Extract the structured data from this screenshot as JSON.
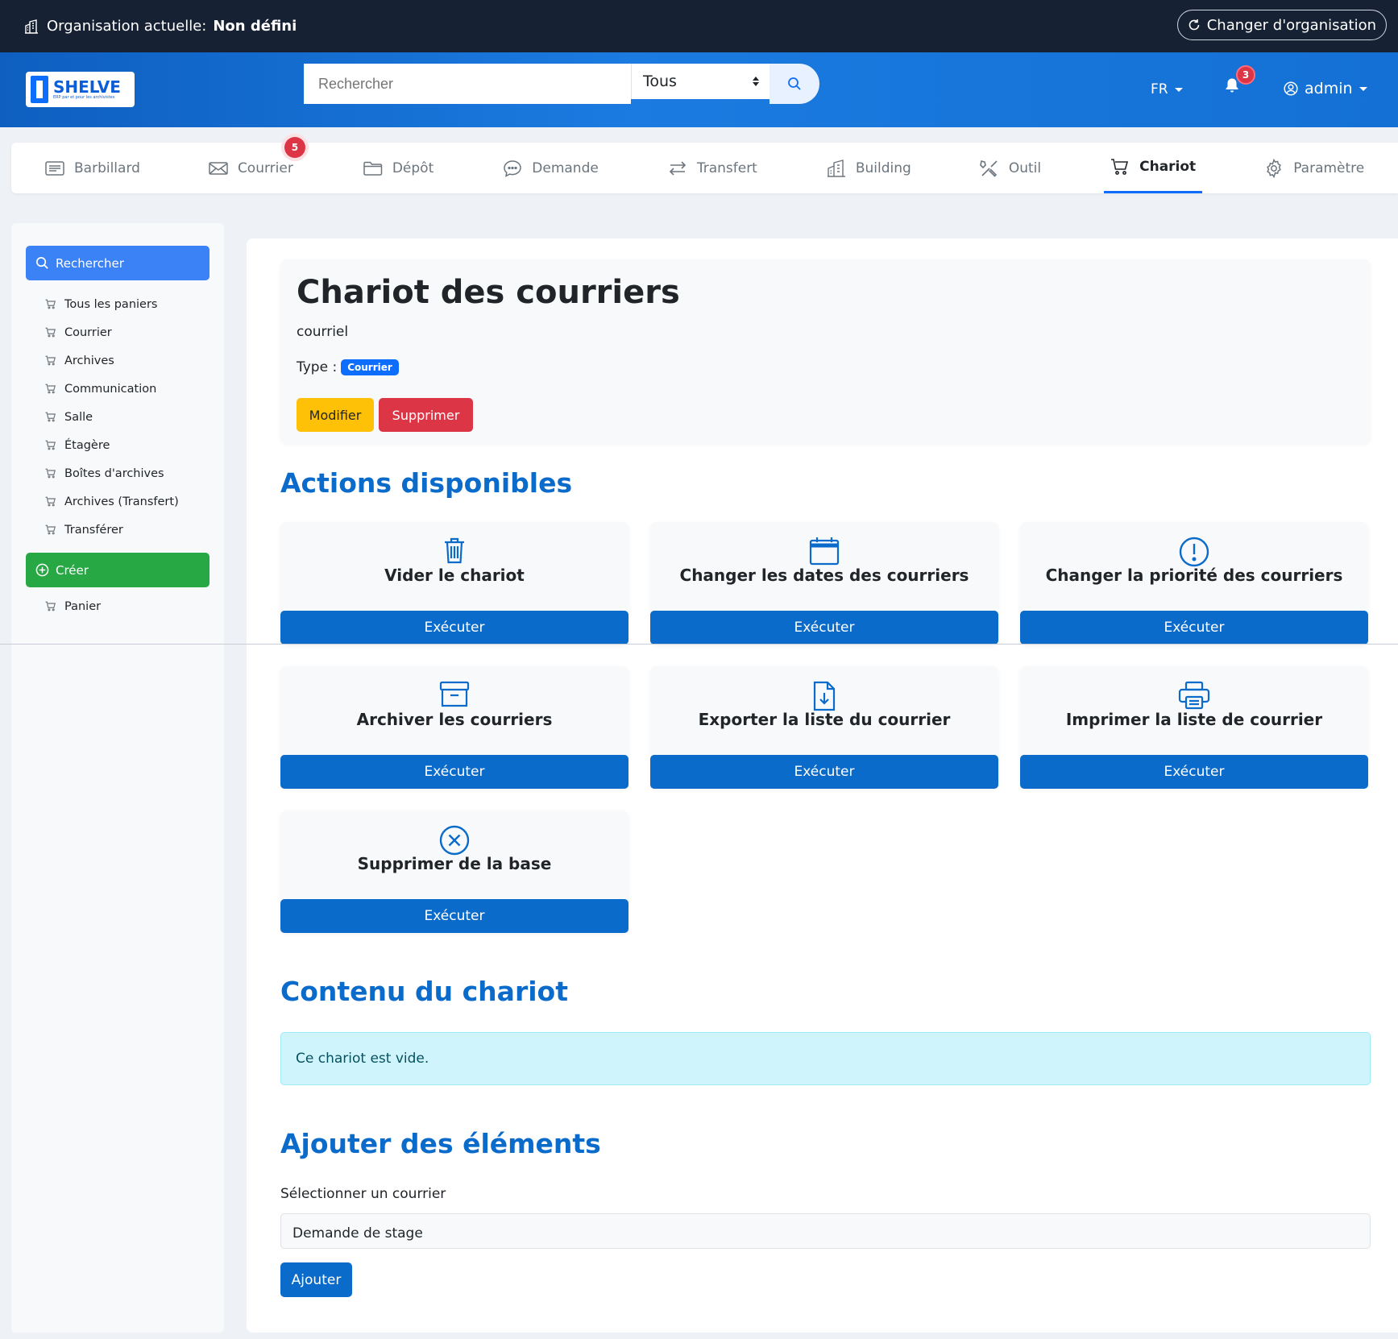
{
  "topbar": {
    "org_label": "Organisation actuelle:",
    "org_value": "Non défini",
    "change_org": "Changer d'organisation"
  },
  "header": {
    "logo_name": "SHELVE",
    "logo_tagline": "ERP par et pour les archivistes",
    "search_placeholder": "Rechercher",
    "search_scope": "Tous",
    "lang": "FR",
    "notifications": "3",
    "user": "admin"
  },
  "nav": [
    {
      "label": "Barbillard",
      "icon": "bulletin-icon"
    },
    {
      "label": "Courrier",
      "icon": "envelope-icon",
      "badge": "5"
    },
    {
      "label": "Dépôt",
      "icon": "folder-icon"
    },
    {
      "label": "Demande",
      "icon": "chat-icon"
    },
    {
      "label": "Transfert",
      "icon": "transfer-arrows-icon"
    },
    {
      "label": "Building",
      "icon": "building-icon"
    },
    {
      "label": "Outil",
      "icon": "tools-icon"
    },
    {
      "label": "Chariot",
      "icon": "cart-icon",
      "active": true
    },
    {
      "label": "Paramètre",
      "icon": "gear-icon"
    }
  ],
  "sidebar": {
    "search_button": "Rechercher",
    "items": [
      "Tous les paniers",
      "Courrier",
      "Archives",
      "Communication",
      "Salle",
      "Étagère",
      "Boîtes d'archives",
      "Archives (Transfert)",
      "Transférer"
    ],
    "create_button": "Créer",
    "create_items": [
      "Panier"
    ]
  },
  "cart": {
    "title": "Chariot des courriers",
    "description": "courriel",
    "type_label": "Type :",
    "type_value": "Courrier",
    "edit_button": "Modifier",
    "delete_button": "Supprimer"
  },
  "actions_section": {
    "title": "Actions disponibles",
    "execute_label": "Exécuter",
    "items": [
      {
        "label": "Vider le chariot",
        "icon": "trash-icon"
      },
      {
        "label": "Changer les dates des courriers",
        "icon": "calendar-icon"
      },
      {
        "label": "Changer la priorité des courriers",
        "icon": "exclamation-circle-icon"
      },
      {
        "label": "Archiver les courriers",
        "icon": "archive-box-icon"
      },
      {
        "label": "Exporter la liste du courrier",
        "icon": "file-download-icon"
      },
      {
        "label": "Imprimer la liste de courrier",
        "icon": "printer-icon"
      },
      {
        "label": "Supprimer de la base",
        "icon": "x-circle-icon"
      }
    ]
  },
  "content_section": {
    "title": "Contenu du chariot",
    "empty_message": "Ce chariot est vide."
  },
  "add_section": {
    "title": "Ajouter des éléments",
    "select_label": "Sélectionner un courrier",
    "select_value": "Demande de stage",
    "add_button": "Ajouter"
  },
  "colors": {
    "topbar": "#172134",
    "primary": "#0b6bcb",
    "success": "#28a745",
    "warning": "#ffc107",
    "danger": "#dc3545",
    "info_bg": "#cff4fc"
  }
}
